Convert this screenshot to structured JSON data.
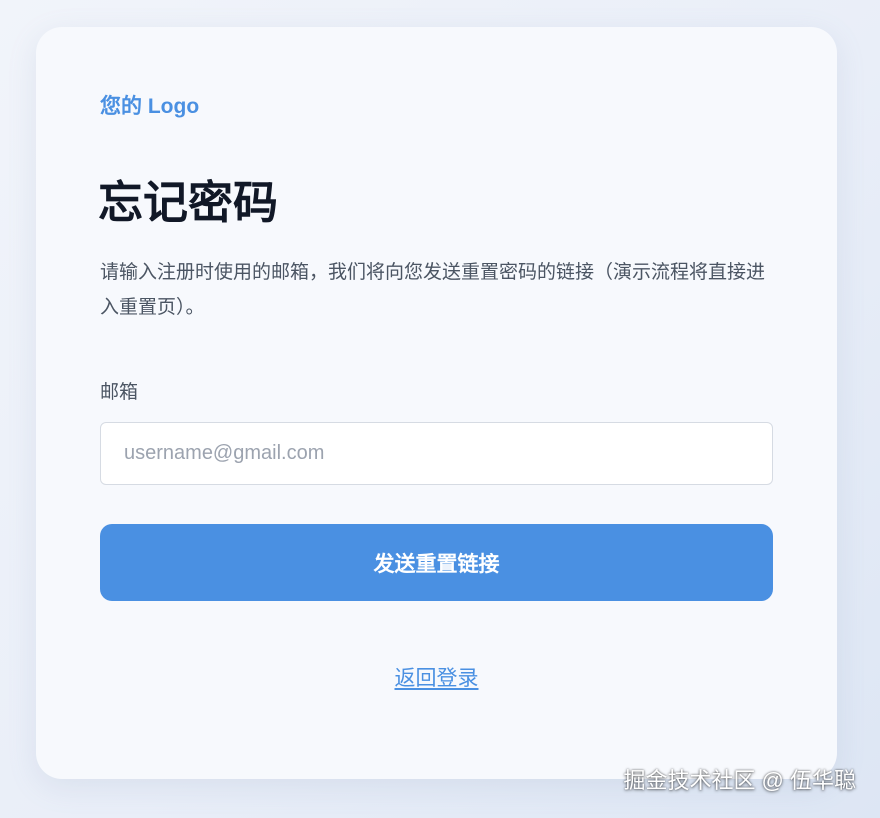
{
  "brand": {
    "logo_text": "您的 Logo",
    "accent_color": "#4a90e2"
  },
  "page": {
    "title": "忘记密码",
    "description": "请输入注册时使用的邮箱，我们将向您发送重置密码的链接（演示流程将直接进入重置页）。"
  },
  "form": {
    "email_label": "邮箱",
    "email_value": "",
    "email_placeholder": "username@gmail.com",
    "submit_label": "发送重置链接"
  },
  "footer": {
    "back_link_label": "返回登录"
  },
  "watermark": {
    "text": "掘金技术社区 @ 伍华聪"
  }
}
